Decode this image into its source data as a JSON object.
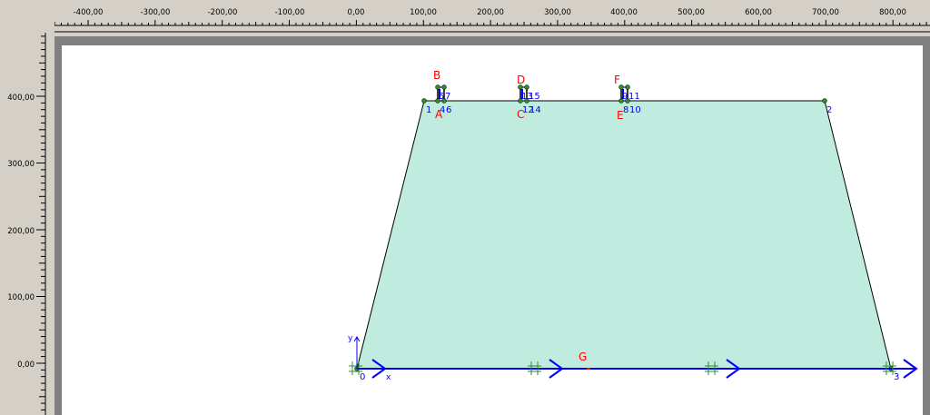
{
  "rulers": {
    "x_ticks": [
      "-400,00",
      "-300,00",
      "-200,00",
      "-100,00",
      "0,00",
      "100,00",
      "200,00",
      "300,00",
      "400,00",
      "500,00",
      "600,00",
      "700,00",
      "800,00"
    ],
    "y_ticks": [
      "400,00",
      "300,00",
      "200,00",
      "100,00",
      "0,00"
    ]
  },
  "geometry": {
    "point_labels": {
      "p0": "0",
      "p1": "1",
      "p2": "2",
      "p3": "3",
      "p4": "4",
      "p5": "5",
      "p6": "6",
      "p7": "7",
      "p8": "8",
      "p9": "9",
      "p10": "10",
      "p11": "11",
      "p12": "12",
      "p13": "13",
      "p14": "14",
      "p15": "15"
    },
    "letters": {
      "A": "A",
      "B": "B",
      "C": "C",
      "D": "D",
      "E": "E",
      "F": "F",
      "G": "G"
    },
    "axes": {
      "x": "x",
      "y": "y"
    }
  },
  "colors": {
    "soil_fill": "#c0ece0",
    "outline": "#000000",
    "fixity": "#0000ff",
    "letter": "#ff0000",
    "node": "#2e8b2e"
  },
  "icons": {
    "support_marker": "hash-cross-icon",
    "load_arrow": "arrow-right-icon"
  }
}
